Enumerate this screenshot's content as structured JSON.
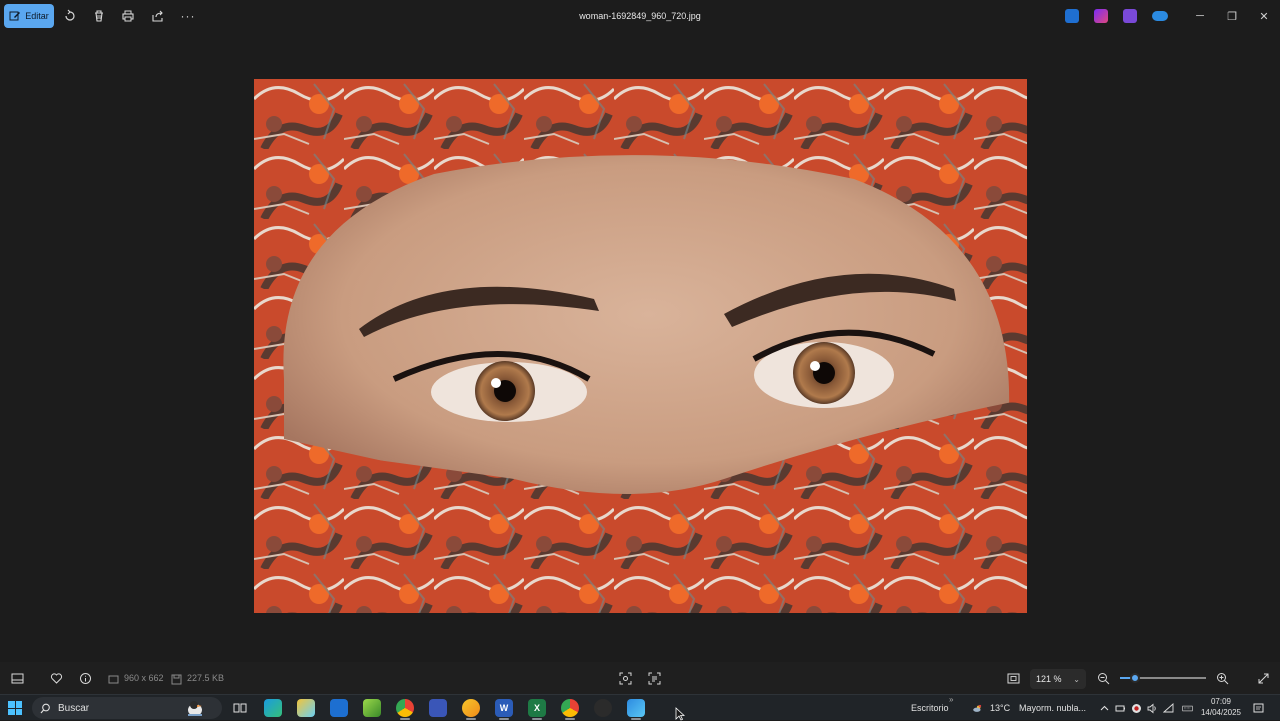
{
  "toolbar": {
    "edit_label": "Editar",
    "filename": "woman-1692849_960_720.jpg",
    "more_label": "···",
    "icons": [
      "rotate-icon",
      "delete-icon",
      "print-icon",
      "share-icon",
      "more-icon"
    ]
  },
  "titlebar": {
    "app_icons": [
      "photo-edit-app-icon",
      "clipchamp-icon",
      "teams-icon",
      "onedrive-icon"
    ],
    "minimize_label": "─",
    "maximize_label": "❐",
    "close_label": "✕"
  },
  "photo": {
    "description_icon": "woman-eyes-scarf-image"
  },
  "bottombar": {
    "dimensions": "960 x 662",
    "file_size": "227.5 KB",
    "zoom_value": "121 %",
    "zoom_level_fraction": 0.18
  },
  "taskbar": {
    "search_placeholder": "Buscar",
    "pinned": [
      {
        "name": "task-view-icon",
        "label": ""
      },
      {
        "name": "edge-icon",
        "label": ""
      },
      {
        "name": "paint-icon",
        "label": ""
      },
      {
        "name": "store-icon",
        "label": ""
      },
      {
        "name": "notepad-plus-icon",
        "label": ""
      },
      {
        "name": "chrome-icon",
        "label": ""
      },
      {
        "name": "monitor-app-icon",
        "label": ""
      },
      {
        "name": "edge-canary-icon",
        "label": ""
      },
      {
        "name": "word-icon",
        "label": "W"
      },
      {
        "name": "excel-icon",
        "label": "X"
      },
      {
        "name": "chrome-profile-icon",
        "label": ""
      },
      {
        "name": "obs-icon",
        "label": ""
      },
      {
        "name": "photos-icon",
        "label": ""
      }
    ],
    "desktop_label": "Escritorio",
    "weather_temp": "13°C",
    "weather_desc": "Mayorm. nubla...",
    "time": "07:09",
    "date": "14/04/2025"
  },
  "colors": {
    "accent": "#5aa7f0",
    "background": "#1c1c1c",
    "taskbar": "#202428"
  }
}
